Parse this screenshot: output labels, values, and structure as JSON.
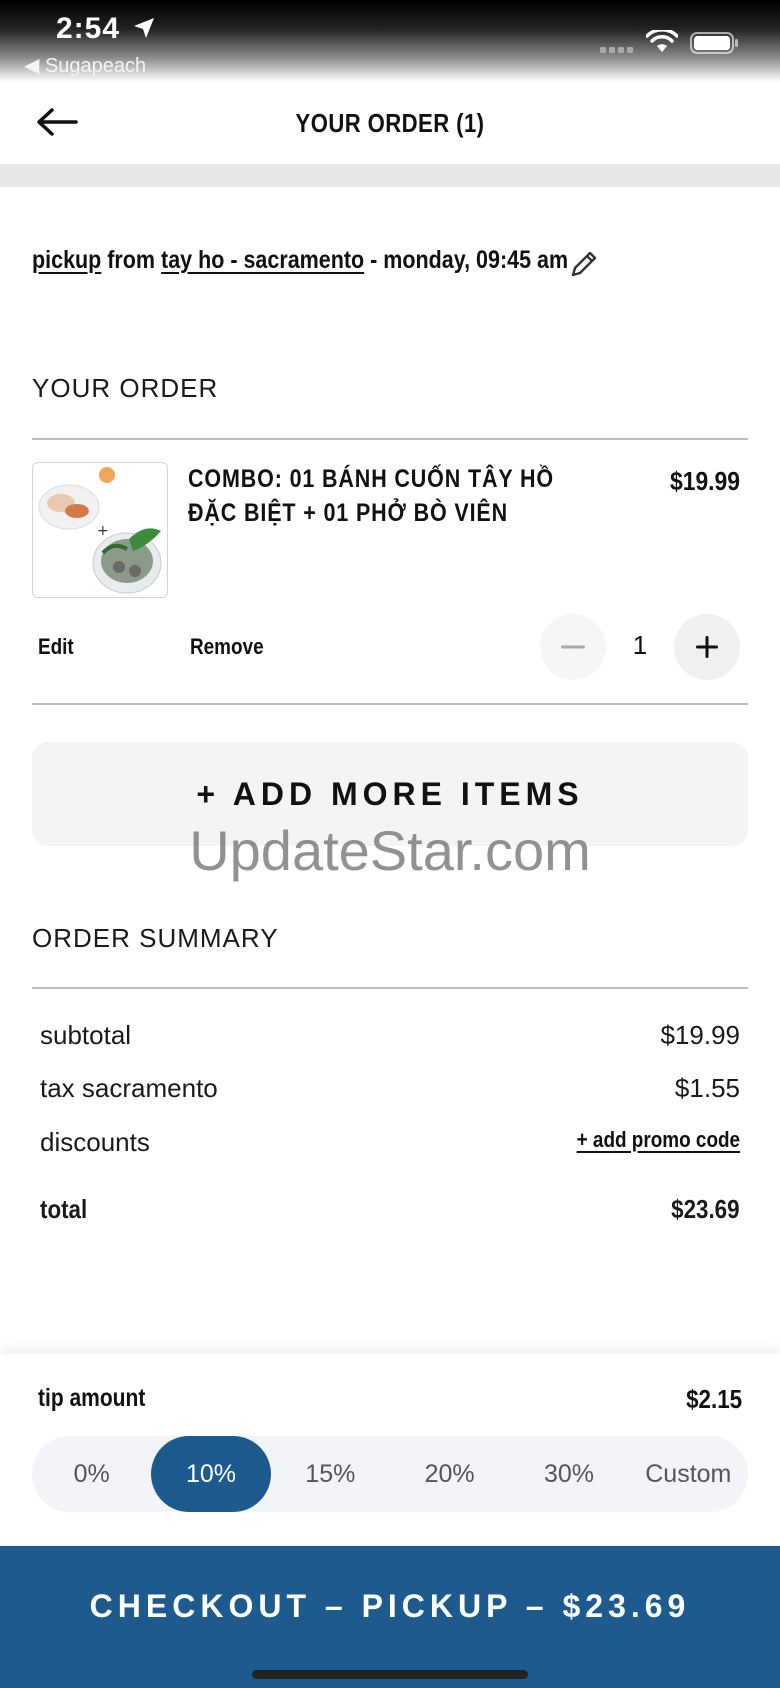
{
  "status_bar": {
    "time": "2:54",
    "back_app": "◀ Sugapeach",
    "icons": [
      "location-arrow-icon",
      "signal-icon",
      "wifi-icon",
      "battery-icon"
    ]
  },
  "header": {
    "title": "YOUR ORDER (1)",
    "back_icon": "arrow-left-icon"
  },
  "pickup": {
    "mode": "pickup",
    "from_word": "from",
    "location": "tay ho - sacramento",
    "time": "- monday, 09:45 am",
    "edit_icon": "pencil-icon"
  },
  "order": {
    "section_title": "YOUR ORDER",
    "items": [
      {
        "name": "COMBO: 01 BÁNH CUỐN TÂY HỒ ĐẶC BIỆT + 01 PHỞ BÒ VIÊN",
        "price": "$19.99",
        "quantity": "1",
        "edit_label": "Edit",
        "remove_label": "Remove"
      }
    ],
    "add_more_label": "+ ADD MORE ITEMS"
  },
  "watermark": "UpdateStar.com",
  "summary": {
    "section_title": "ORDER SUMMARY",
    "subtotal_label": "subtotal",
    "subtotal_value": "$19.99",
    "tax_label": "tax sacramento",
    "tax_value": "$1.55",
    "discounts_label": "discounts",
    "promo_label": "+ add promo code",
    "total_label": "total",
    "total_value": "$23.69"
  },
  "tip": {
    "label": "tip amount",
    "amount": "$2.15",
    "options": [
      "0%",
      "10%",
      "15%",
      "20%",
      "30%",
      "Custom"
    ],
    "selected": "10%"
  },
  "checkout": {
    "label": "CHECKOUT – PICKUP – $23.69"
  },
  "colors": {
    "accent": "#1d5b8e",
    "pill_bg": "#f3f4f7",
    "divider": "#e8e8e8"
  }
}
